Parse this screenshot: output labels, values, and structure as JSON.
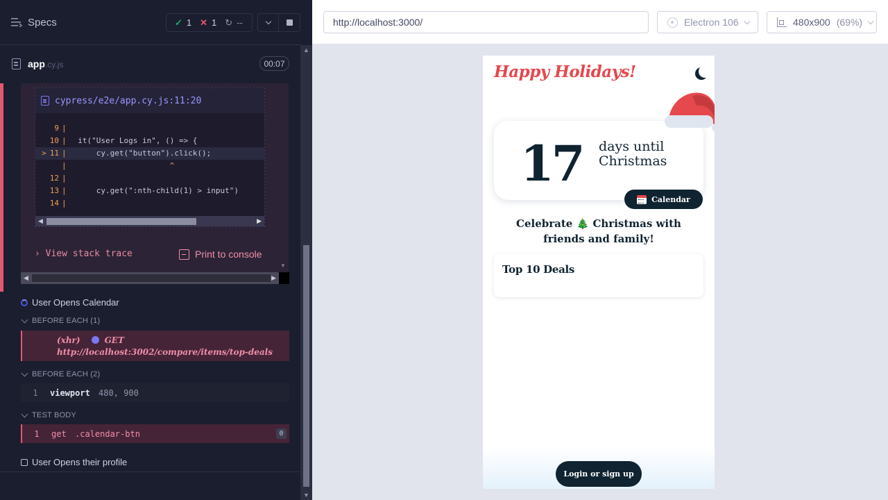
{
  "reporter": {
    "specs_label": "Specs",
    "stats": {
      "passed": "1",
      "failed": "1",
      "pending": "--"
    },
    "file": {
      "name": "app",
      "ext": ".cy.js",
      "duration": "00:07"
    },
    "error": {
      "file_path": "cypress/e2e/app.cy.js:11:20",
      "code_lines": [
        {
          "num": "9",
          "code": ""
        },
        {
          "num": "10",
          "code": "  it(\"User Logs in\", () => {"
        },
        {
          "num": "11",
          "code": "      cy.get(\"button\").click();"
        },
        {
          "num": "",
          "code": "                      ^"
        },
        {
          "num": "12",
          "code": ""
        },
        {
          "num": "13",
          "code": "      cy.get(\":nth-child(1) > input\")"
        },
        {
          "num": "14",
          "code": ""
        }
      ],
      "stack_trace_label": "View stack trace",
      "print_console_label": "Print to console"
    },
    "tests": [
      {
        "title": "User Opens Calendar",
        "state": "running"
      },
      {
        "title": "User Opens their profile",
        "state": "pending"
      }
    ],
    "hooks": {
      "before_each_1": {
        "label": "BEFORE EACH (1)",
        "xhr_label": "(xhr)",
        "xhr_method": "GET",
        "xhr_url": "http://localhost:3002/compare/items/top-deals"
      },
      "before_each_2": {
        "label": "BEFORE EACH (2)",
        "cmd_num": "1",
        "cmd_name": "viewport",
        "cmd_args": "480, 900"
      },
      "test_body": {
        "label": "TEST BODY",
        "cmd_num": "1",
        "cmd_name": "get",
        "cmd_args": ".calendar-btn",
        "badge": "0"
      }
    }
  },
  "aut": {
    "url": "http://localhost:3000/",
    "browser": "Electron 106",
    "viewport": "480x900",
    "viewport_pct": "(69%)"
  },
  "app": {
    "title": "Happy Holidays!",
    "days": "17",
    "days_label": "days until Christmas",
    "calendar_btn": "Calendar",
    "celebrate": "Celebrate 🎄 Christmas with friends and family!",
    "deals_title": "Top 10 Deals",
    "login_btn": "Login or sign up"
  },
  "colors": {
    "pass": "#1fa971",
    "fail": "#e45770",
    "accent": "#7b78f0",
    "app_primary": "#0f2330",
    "app_red": "#e5484d"
  }
}
